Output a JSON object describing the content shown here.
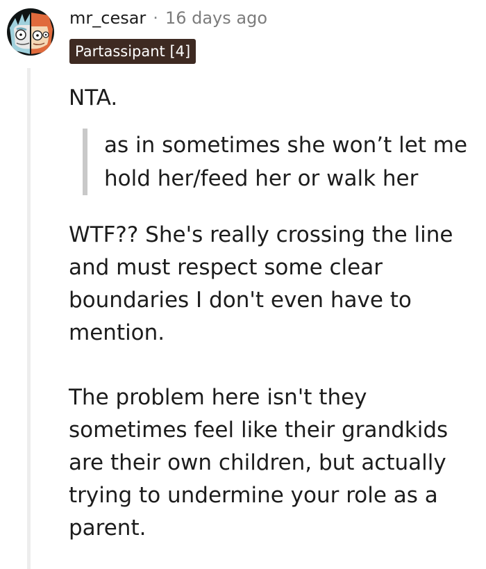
{
  "comment": {
    "username": "mr_cesar",
    "separator": "·",
    "timestamp": "16 days ago",
    "flair": "Partassipant [4]",
    "paragraphs": {
      "p1": "NTA.",
      "quote": "as in sometimes she won’t let me hold her/feed her or walk her",
      "p2": "WTF?? She's really crossing the line and must respect some clear boundaries I don't even have to mention.",
      "p3": "The problem here isn't they sometimes feel like their grandkids are their own children, but actually trying to undermine your role as a parent."
    }
  },
  "colors": {
    "flair_bg": "#3e2a22",
    "thread_line": "#ededed",
    "quote_bar": "#c9c9c9",
    "timestamp": "#7c7c7c"
  },
  "icons": {
    "avatar": "rick-and-morty-avatar"
  }
}
